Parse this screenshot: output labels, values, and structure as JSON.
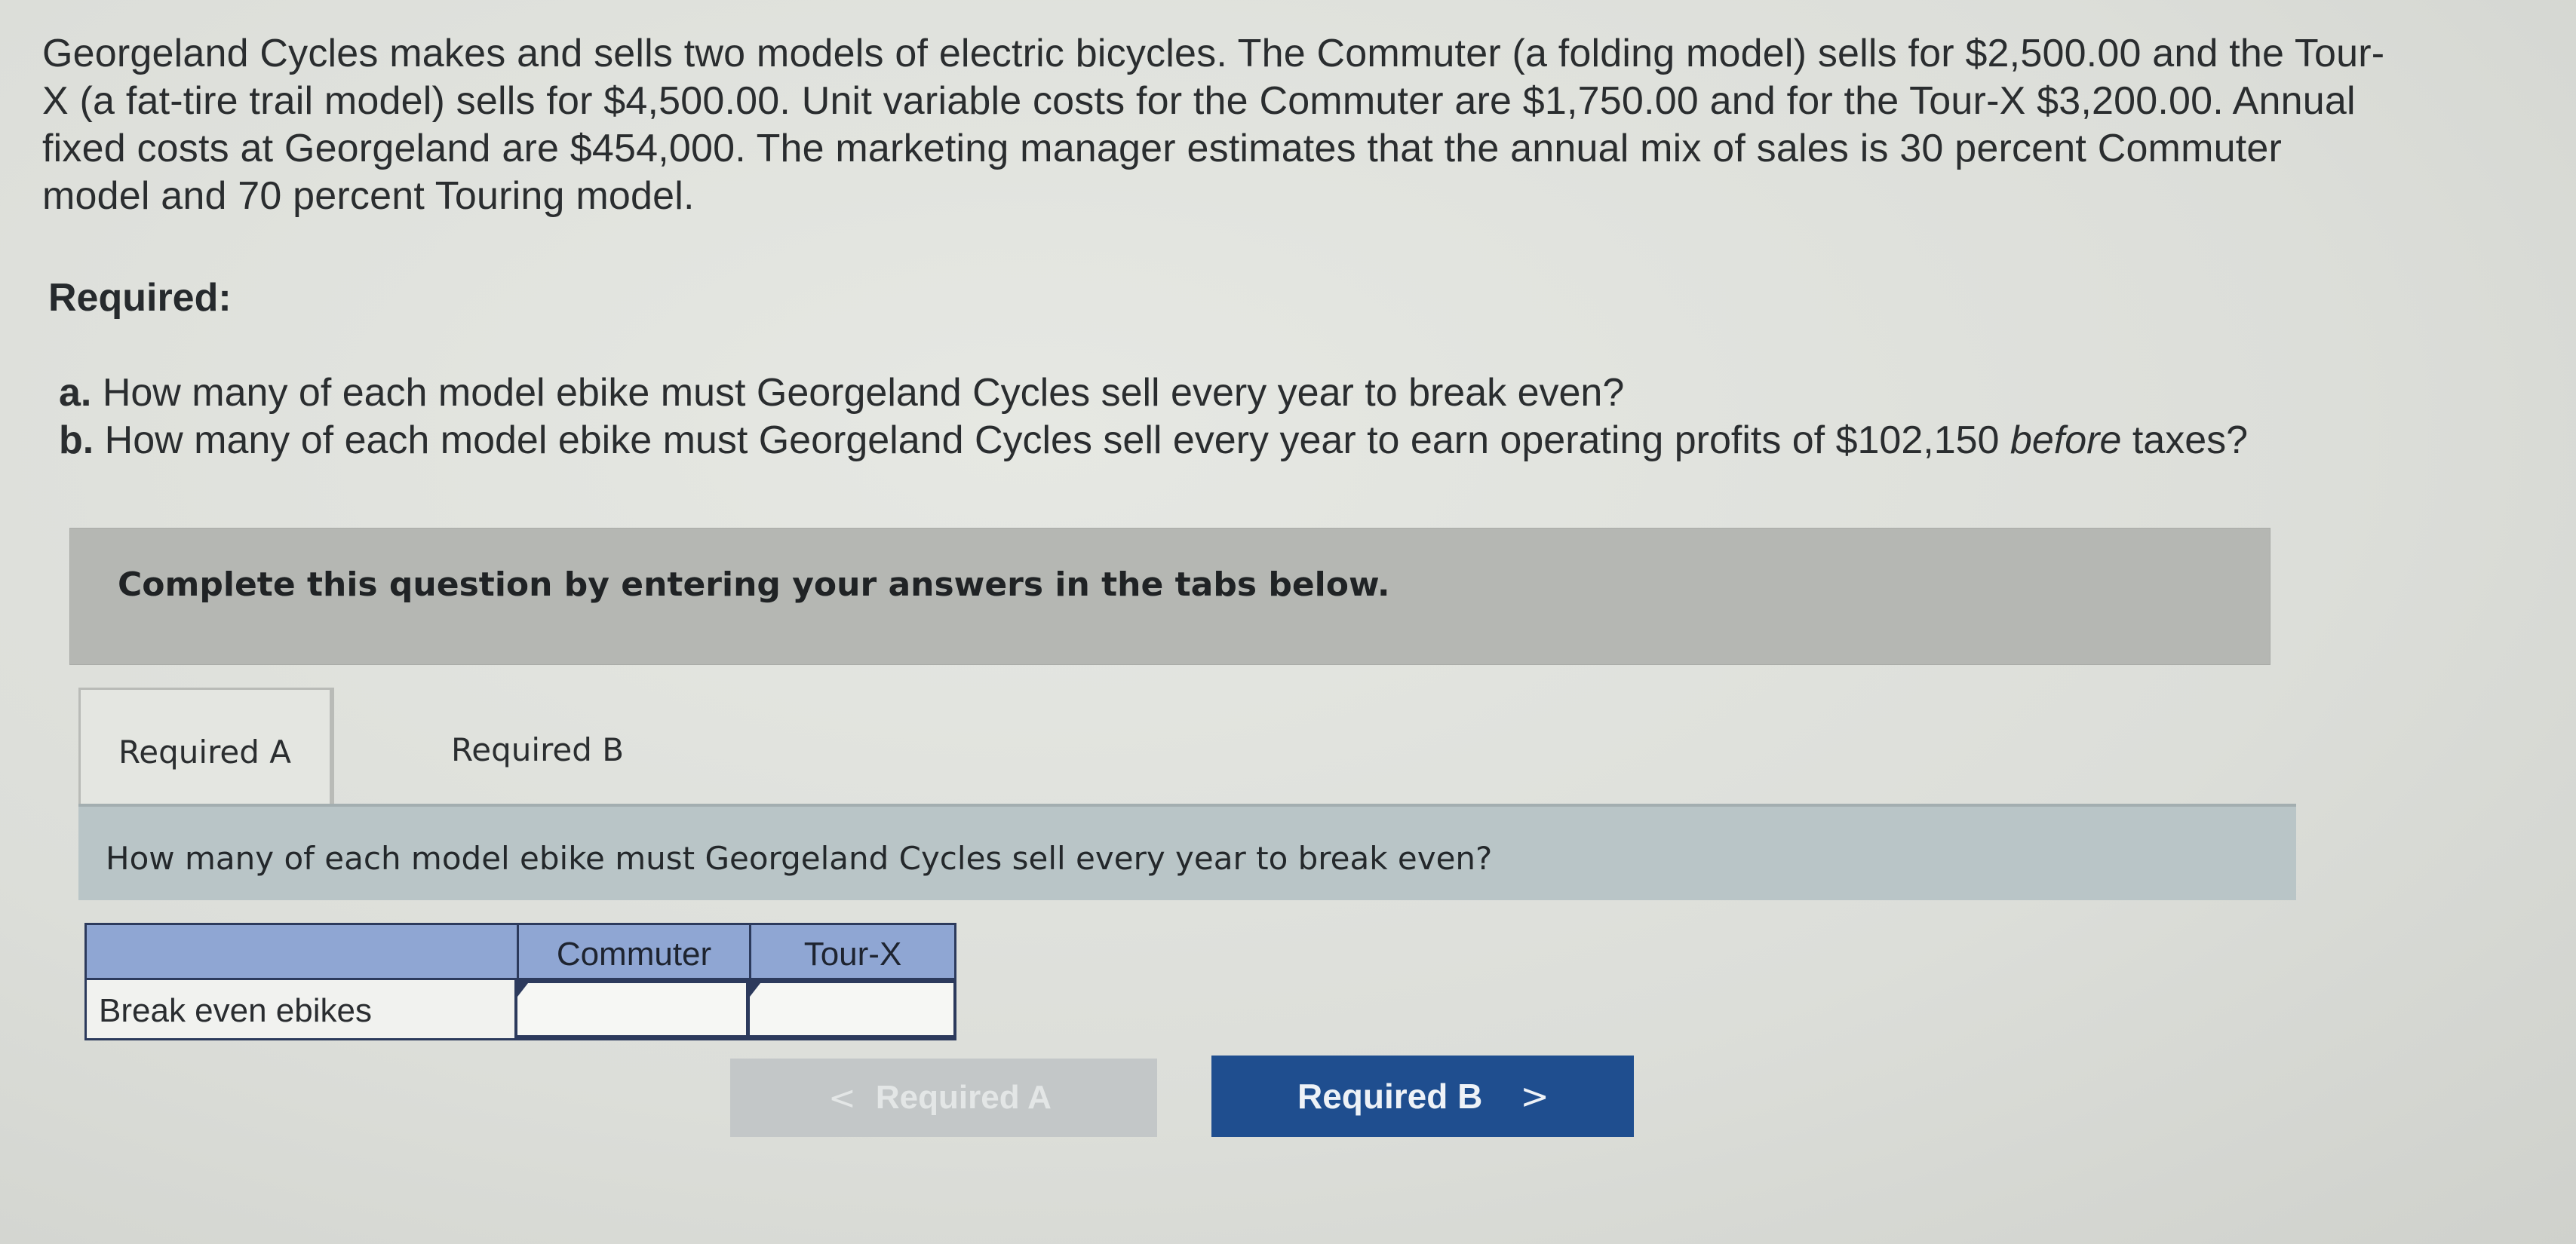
{
  "problem": {
    "line1": "Georgeland Cycles makes and sells two models of electric bicycles. The Commuter (a folding model) sells for $2,500.00 and the Tour-",
    "line2": "X (a fat-tire trail model) sells for $4,500.00. Unit variable costs for the Commuter are $1,750.00 and for the Tour-X $3,200.00. Annual",
    "line3": "fixed costs at Georgeland are $454,000. The marketing manager estimates that the annual mix of sales is 30 percent Commuter",
    "line4": "model and 70 percent Touring model."
  },
  "required": {
    "heading": "Required:",
    "a_letter": "a.",
    "a_text": "How many of each model ebike must Georgeland Cycles sell every year to break even?",
    "b_letter": "b.",
    "b_text_1": "How many of each model ebike must Georgeland Cycles sell every year to earn operating profits of $102,150",
    "b_text_italic": "before",
    "b_text_2": "taxes?"
  },
  "instruction": "Complete this question by entering your answers in the tabs below.",
  "tabs": [
    {
      "label": "Required A",
      "active": true
    },
    {
      "label": "Required B",
      "active": false
    }
  ],
  "question": "How many of each model ebike must Georgeland Cycles sell every year to break even?",
  "table": {
    "columns": [
      "",
      "Commuter",
      "Tour-X"
    ],
    "rows": [
      {
        "label": "Break even ebikes",
        "commuter": "",
        "tourx": ""
      }
    ]
  },
  "nav": {
    "prev_label": "Required A",
    "prev_chevron": "<",
    "next_label": "Required B",
    "next_chevron": ">"
  },
  "colors": {
    "table_header": "#8fa6d3",
    "next_button": "#1f4e8f",
    "instruction_box": "#b5b7b3",
    "question_band": "#b9c5c7"
  }
}
